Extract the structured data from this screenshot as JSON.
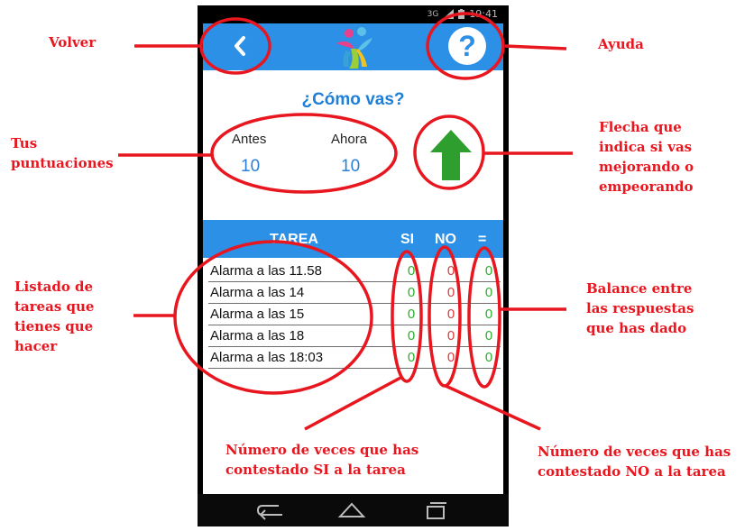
{
  "status": {
    "network": "3G",
    "time": "19:41"
  },
  "appbar": {
    "back_icon": "chevron-left-icon",
    "help_icon": "question-mark-icon",
    "help_glyph": "?"
  },
  "main": {
    "title": "¿Cómo vas?",
    "before_label": "Antes",
    "before_value": "10",
    "now_label": "Ahora",
    "now_value": "10",
    "trend": "up",
    "trend_color": "#2e9e2e"
  },
  "table": {
    "headers": {
      "task": "TAREA",
      "si": "SI",
      "no": "NO",
      "eq": "="
    },
    "rows": [
      {
        "task": "Alarma a las 11.58",
        "si": "0",
        "no": "0",
        "eq": "0"
      },
      {
        "task": "Alarma a las 14",
        "si": "0",
        "no": "0",
        "eq": "0"
      },
      {
        "task": "Alarma a las 15",
        "si": "0",
        "no": "0",
        "eq": "0"
      },
      {
        "task": "Alarma a las 18",
        "si": "0",
        "no": "0",
        "eq": "0"
      },
      {
        "task": "Alarma a las 18:03",
        "si": "0",
        "no": "0",
        "eq": "0"
      }
    ]
  },
  "annotations": {
    "volver": "Volver",
    "ayuda": "Ayuda",
    "puntuaciones": "Tus\npuntuaciones",
    "flecha": "Flecha que\nindica si vas\nmejorando o\nempeorando",
    "listado": "Listado de\ntareas que\ntienes que\nhacer",
    "balance": "Balance entre\nlas respuestas\nque has dado",
    "veces_si": "Número de veces que has\ncontestado SI a la tarea",
    "veces_no": "Número de veces que has\ncontestado NO a la tarea"
  },
  "colors": {
    "accent": "#2b90e6",
    "annotation": "#e8161f",
    "positive": "#2bb02b",
    "negative": "#e03a3a"
  }
}
